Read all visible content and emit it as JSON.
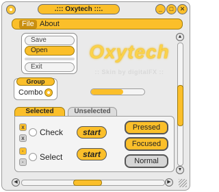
{
  "window": {
    "title": ".::: Oxytech :::.",
    "min_glyph": "_",
    "max_glyph": "□",
    "close_glyph": "✕"
  },
  "menubar": {
    "items": [
      {
        "label": "File"
      },
      {
        "label": "About"
      }
    ]
  },
  "list": {
    "items": [
      {
        "label": "Save",
        "selected": false
      },
      {
        "label": "Open",
        "selected": true
      },
      {
        "label": "",
        "separator": true
      },
      {
        "label": "Exit",
        "selected": false
      }
    ]
  },
  "logo": {
    "text": "Oxytech",
    "subtitle": ":: Skin by digitalFX ::"
  },
  "group": {
    "title": "Group",
    "combo_label": "Combo"
  },
  "progress": {
    "value_percent": 60
  },
  "tabs": [
    {
      "label": "Selected",
      "active": true
    },
    {
      "label": "Unselected",
      "active": false
    }
  ],
  "controls": {
    "check_label": "Check",
    "select_label": "Select",
    "start_label": "start",
    "check_marks": [
      "x",
      "x",
      "·",
      "·"
    ],
    "state_buttons": [
      {
        "label": "Pressed"
      },
      {
        "label": "Focused"
      },
      {
        "label": "Normal"
      }
    ]
  },
  "scrollbars": {
    "arrow_up": "▲",
    "arrow_down": "▼",
    "arrow_left": "◀",
    "arrow_right": "▶"
  },
  "colors": {
    "accent": "#fbbf2a",
    "accent_dark": "#c98f10",
    "frame": "#eaeaea"
  }
}
